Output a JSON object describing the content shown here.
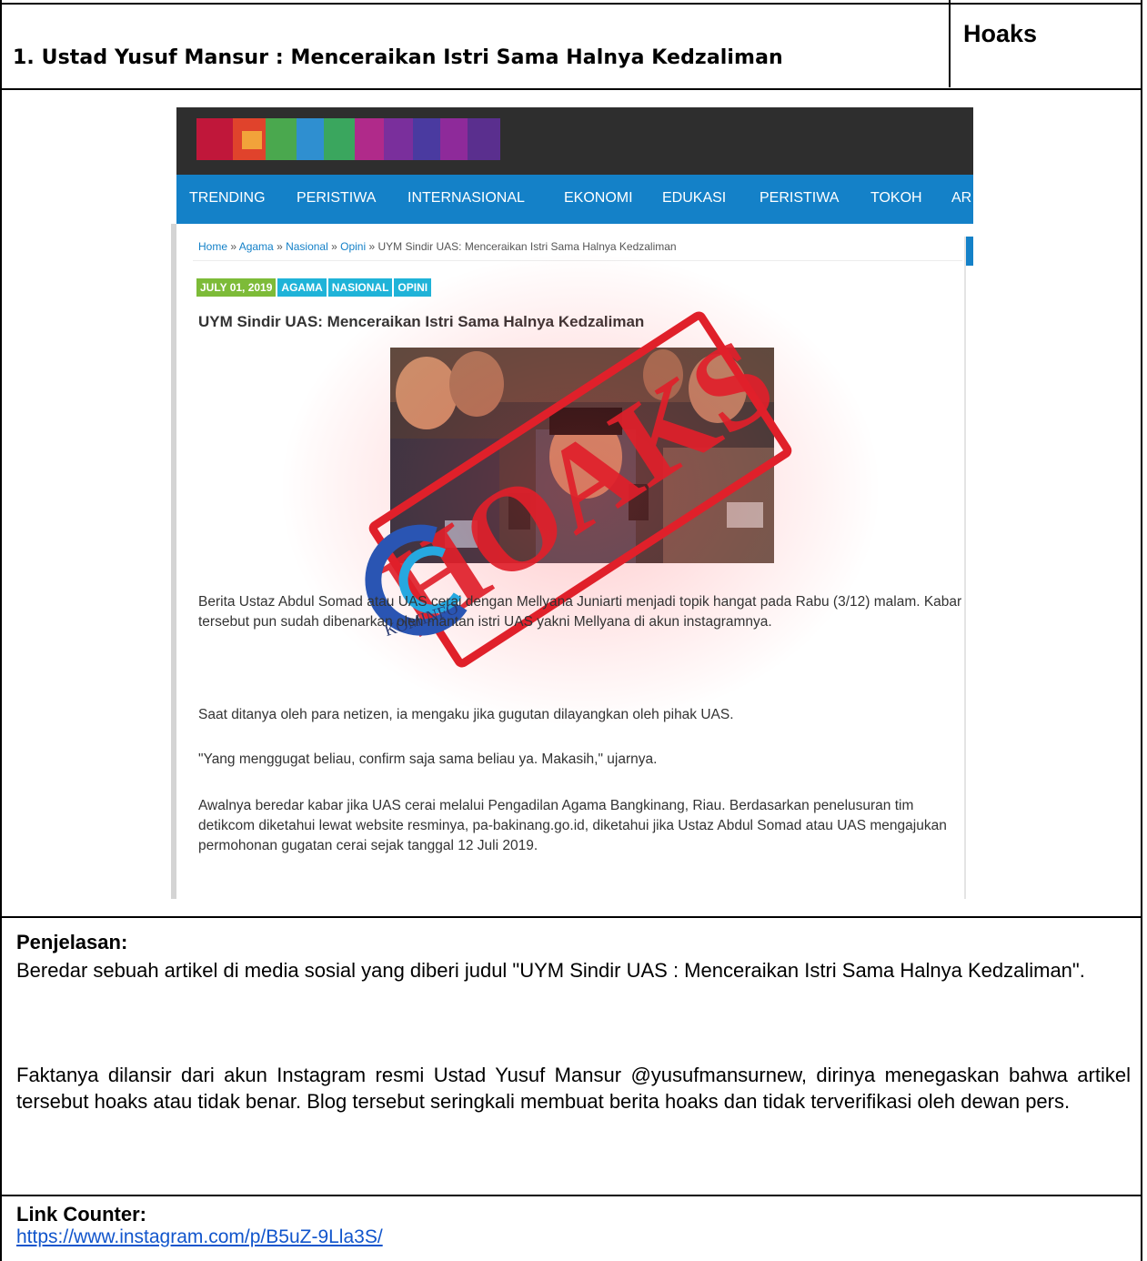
{
  "header": {
    "title": "1. Ustad Yusuf Mansur : Menceraikan Istri Sama Halnya Kedzaliman",
    "verdict": "Hoaks"
  },
  "screenshot": {
    "nav": [
      "TRENDING",
      "PERISTIWA",
      "INTERNASIONAL",
      "EKONOMI",
      "EDUKASI",
      "PERISTIWA",
      "TOKOH",
      "AR"
    ],
    "breadcrumb": {
      "home": "Home",
      "sep": " » ",
      "agama": "Agama",
      "nasional": "Nasional",
      "opini": "Opini",
      "current": "UYM Sindir UAS: Menceraikan Istri Sama Halnya Kedzaliman"
    },
    "tags": {
      "date": "JULY 01, 2019",
      "cat1": "AGAMA",
      "cat2": "NASIONAL",
      "cat3": "OPINI"
    },
    "article_title": "UYM Sindir UAS: Menceraikan Istri Sama Halnya Kedzaliman",
    "stamp_text": "HOAKS",
    "logo_text": "KOMINFO",
    "paragraphs": [
      "Berita Ustaz Abdul Somad atau UAS cerai dengan Mellyana Juniarti menjadi topik hangat pada Rabu (3/12) malam. Kabar tersebut pun sudah dibenarkan oleh mantan istri UAS yakni Mellyana di akun instagramnya.",
      "Saat ditanya oleh para netizen, ia mengaku jika gugutan dilayangkan oleh pihak UAS.",
      "\"Yang menggugat beliau, confirm saja sama beliau ya. Makasih,\" ujarnya.",
      "Awalnya beredar kabar jika UAS cerai melalui Pengadilan Agama Bangkinang, Riau. Berdasarkan penelusuran tim detikcom diketahui lewat website resminya, pa-bakinang.go.id, diketahui jika Ustaz Abdul Somad atau UAS mengajukan permohonan gugatan cerai sejak tanggal 12 Juli 2019."
    ],
    "colors": {
      "nav_bg": "#1481c8",
      "header_bg": "#2e2e2e",
      "date_tag": "#7dbb38",
      "cat_tag": "#1fb3d8",
      "stamp": "#e0202a"
    }
  },
  "explanation": {
    "label": "Penjelasan:",
    "p1": "Beredar sebuah artikel di media sosial yang diberi judul \"UYM Sindir UAS : Menceraikan Istri Sama Halnya Kedzaliman\".",
    "p2": "Faktanya dilansir dari akun Instagram resmi Ustad Yusuf Mansur @yusufmansurnew, dirinya menegaskan bahwa artikel tersebut hoaks atau tidak benar. Blog tersebut seringkali membuat berita hoaks dan tidak terverifikasi oleh dewan pers."
  },
  "counter": {
    "label": "Link Counter:",
    "url": "https://www.instagram.com/p/B5uZ-9Lla3S/"
  }
}
